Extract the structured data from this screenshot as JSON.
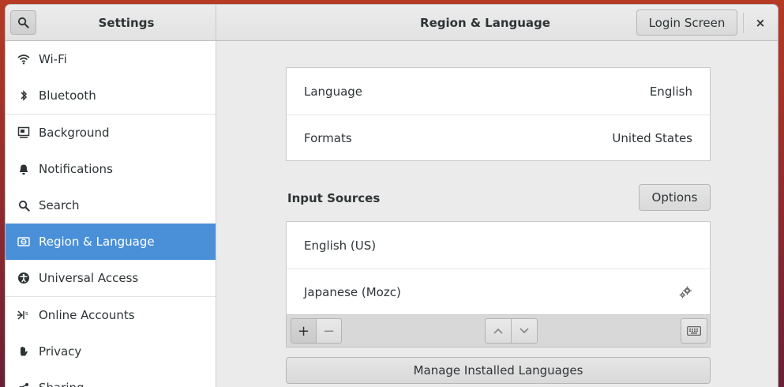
{
  "header": {
    "sidebar_title": "Settings",
    "page_title": "Region & Language",
    "login_screen_label": "Login Screen",
    "close_label": "×"
  },
  "sidebar": {
    "items": [
      {
        "label": "Wi-Fi",
        "icon": "wifi-icon"
      },
      {
        "label": "Bluetooth",
        "icon": "bluetooth-icon"
      },
      {
        "label": "Background",
        "icon": "background-icon"
      },
      {
        "label": "Notifications",
        "icon": "bell-icon"
      },
      {
        "label": "Search",
        "icon": "search-icon"
      },
      {
        "label": "Region & Language",
        "icon": "region-icon",
        "active": true
      },
      {
        "label": "Universal Access",
        "icon": "accessibility-icon"
      },
      {
        "label": "Online Accounts",
        "icon": "online-accounts-icon"
      },
      {
        "label": "Privacy",
        "icon": "hand-icon"
      },
      {
        "label": "Sharing",
        "icon": "sharing-icon"
      }
    ]
  },
  "main": {
    "language": {
      "label": "Language",
      "value": "English"
    },
    "formats": {
      "label": "Formats",
      "value": "United States"
    },
    "input_sources": {
      "title": "Input Sources",
      "options_label": "Options",
      "items": [
        {
          "label": "English (US)"
        },
        {
          "label": "Japanese (Mozc)",
          "has_settings": true
        }
      ],
      "add_label": "+",
      "remove_label": "−"
    },
    "manage_label": "Manage Installed Languages"
  },
  "colors": {
    "accent": "#4a90d9",
    "window_bg": "#ebebeb"
  }
}
